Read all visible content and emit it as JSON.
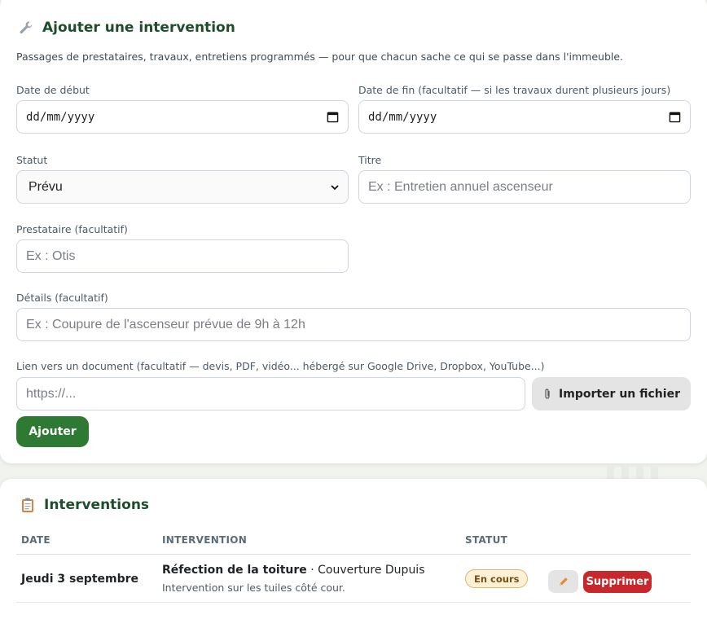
{
  "form": {
    "title": "Ajouter une intervention",
    "title_icon": "wrench-icon",
    "intro": "Passages de prestataires, travaux, entretiens programmés — pour que chacun sache ce qui se passe dans l'immeuble.",
    "start_date": {
      "label": "Date de début",
      "value": "dd/mm/yyyy"
    },
    "end_date": {
      "label": "Date de fin (facultatif — si les travaux durent plusieurs jours)",
      "value": "dd/mm/yyyy"
    },
    "status": {
      "label": "Statut",
      "value": "Prévu"
    },
    "title_field": {
      "label": "Titre",
      "placeholder": "Ex : Entretien annuel ascenseur"
    },
    "provider": {
      "label": "Prestataire (facultatif)",
      "placeholder": "Ex : Otis"
    },
    "details": {
      "label": "Détails (facultatif)",
      "placeholder": "Ex : Coupure de l'ascenseur prévue de 9h à 12h"
    },
    "link": {
      "label": "Lien vers un document (facultatif — devis, PDF, vidéo... hébergé sur Google Drive, Dropbox, YouTube...)",
      "placeholder": "https://..."
    },
    "upload_label": "Importer un fichier",
    "add_label": "Ajouter"
  },
  "list": {
    "title": "Interventions",
    "title_icon": "clipboard-icon",
    "columns": [
      "DATE",
      "INTERVENTION",
      "STATUT"
    ],
    "rows": [
      {
        "date": "Jeudi 3 septembre",
        "title": "Réfection de la toiture",
        "provider": "Couverture Dupuis",
        "details": "Intervention sur les tuiles côté cour.",
        "status": "En cours",
        "delete_label": "Supprimer"
      }
    ]
  },
  "colors": {
    "accent_green": "#2f7a33",
    "title_green": "#1e4d2b",
    "danger_red": "#c8282b",
    "badge_bg": "#fcf0d5"
  }
}
